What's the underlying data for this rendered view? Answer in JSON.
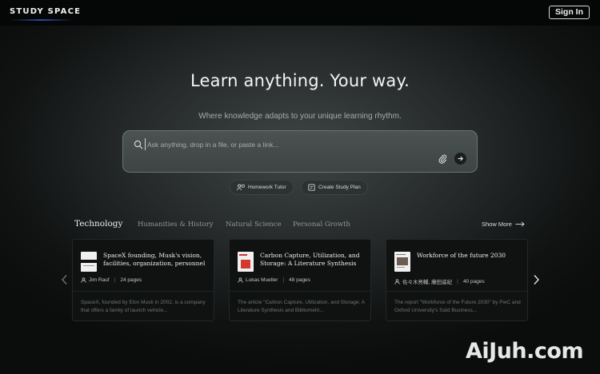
{
  "header": {
    "logo": "STUDY SPACE",
    "signin_label": "Sign In"
  },
  "hero": {
    "title": "Learn anything. Your way.",
    "subtitle": "Where knowledge adapts to your unique learning rhythm."
  },
  "search": {
    "placeholder": "Ask anything, drop in a file, or paste a link...",
    "value": "",
    "icon": "search-icon",
    "attach_icon": "paperclip-icon",
    "submit_icon": "arrow-right-icon"
  },
  "chips": [
    {
      "label": "Homework Tutor",
      "icon": "tutor-icon"
    },
    {
      "label": "Create Study Plan",
      "icon": "plan-icon"
    }
  ],
  "categories": {
    "tabs": [
      {
        "label": "Technology",
        "active": true
      },
      {
        "label": "Humanities & History",
        "active": false
      },
      {
        "label": "Natural Science",
        "active": false
      },
      {
        "label": "Personal Growth",
        "active": false
      }
    ],
    "show_more": "Show More"
  },
  "cards": [
    {
      "title": "SpaceX founding, Musk's vision, facilities, organization, personnel",
      "author": "Jim Rauf",
      "pages": "24 pages",
      "description": "SpaceX, founded by Elon Musk in 2002, is a company that offers a family of launch vehicle...",
      "thumb_icon": "document-thumbnail-icon"
    },
    {
      "title": "Carbon Capture, Utilization, and Storage: A Literature Synthesis an...",
      "author": "Lukas Mueller",
      "pages": "48 pages",
      "description": "The article \"Carbon Capture, Utilization, and Storage: A Literature Synthesis and Bibliometri...",
      "thumb_icon": "document-thumbnail-icon"
    },
    {
      "title": "Workforce of the future 2030",
      "author": "佐々木亮輔, 藤田遥紀",
      "pages": "40 pages",
      "description": "The report \"Workforce of the Future 2030\" by PwC and Oxford University's Saïd Business...",
      "thumb_icon": "document-thumbnail-icon"
    }
  ],
  "carousel": {
    "prev_icon": "chevron-left-icon",
    "next_icon": "chevron-right-icon"
  },
  "watermark": "AiJuh.com",
  "colors": {
    "background": "#262a2a",
    "topbar": "#050606",
    "card": "#101212",
    "searchbox": "#454c4b"
  }
}
